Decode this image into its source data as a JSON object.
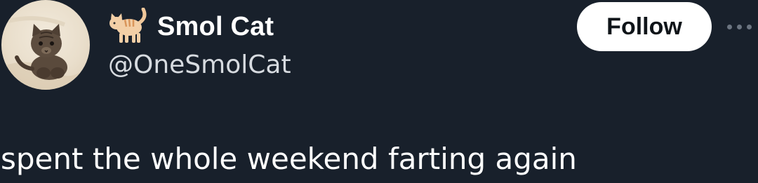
{
  "author": {
    "display_name": "Smol Cat",
    "handle": "@OneSmolCat",
    "avatar_icon": "kitten-photo",
    "name_emoji_icon": "cat-emoji-icon"
  },
  "actions": {
    "follow_label": "Follow",
    "more_icon": "more-options-icon"
  },
  "tweet": {
    "text": "spent the whole weekend farting again"
  },
  "colors": {
    "background": "#18202b",
    "text": "#ffffff",
    "handle": "#d7dbe0",
    "follow_bg": "#ffffff",
    "follow_text": "#0f1419"
  }
}
